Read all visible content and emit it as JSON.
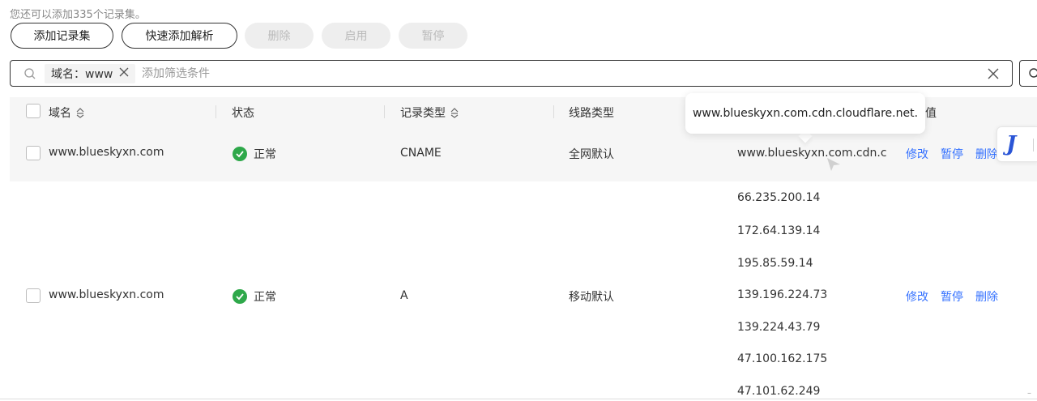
{
  "quota_text": "您还可以添加335个记录集。",
  "toolbar": {
    "add_record": "添加记录集",
    "quick_add": "快速添加解析",
    "delete": "删除",
    "enable": "启用",
    "pause": "暂停"
  },
  "filter": {
    "chip_label": "域名：www",
    "placeholder": "添加筛选条件"
  },
  "table": {
    "headers": {
      "name": "域名",
      "status": "状态",
      "type": "记录类型",
      "line": "线路类型",
      "value_partial": "值"
    },
    "rows": [
      {
        "name": "www.blueskyxn.com",
        "status": "正常",
        "type": "CNAME",
        "line": "全网默认",
        "values": [
          "www.blueskyxn.com.cdn.c"
        ],
        "actions": [
          "修改",
          "暂停",
          "删除"
        ]
      },
      {
        "name": "www.blueskyxn.com",
        "status": "正常",
        "type": "A",
        "line": "移动默认",
        "values": [
          "66.235.200.14",
          "172.64.139.14",
          "195.85.59.14",
          "139.196.224.73",
          "139.224.43.79",
          "47.100.162.175",
          "47.101.62.249"
        ],
        "actions": [
          "修改",
          "暂停",
          "删除"
        ]
      }
    ]
  },
  "tooltip_text": "www.blueskyxn.com.cdn.cloudflare.net.",
  "float_logo_text": "J",
  "colors": {
    "accent": "#3370ff",
    "status_ok": "#2ea84a",
    "header_bg": "#f6f6f6",
    "logo": "#2a55d6"
  }
}
